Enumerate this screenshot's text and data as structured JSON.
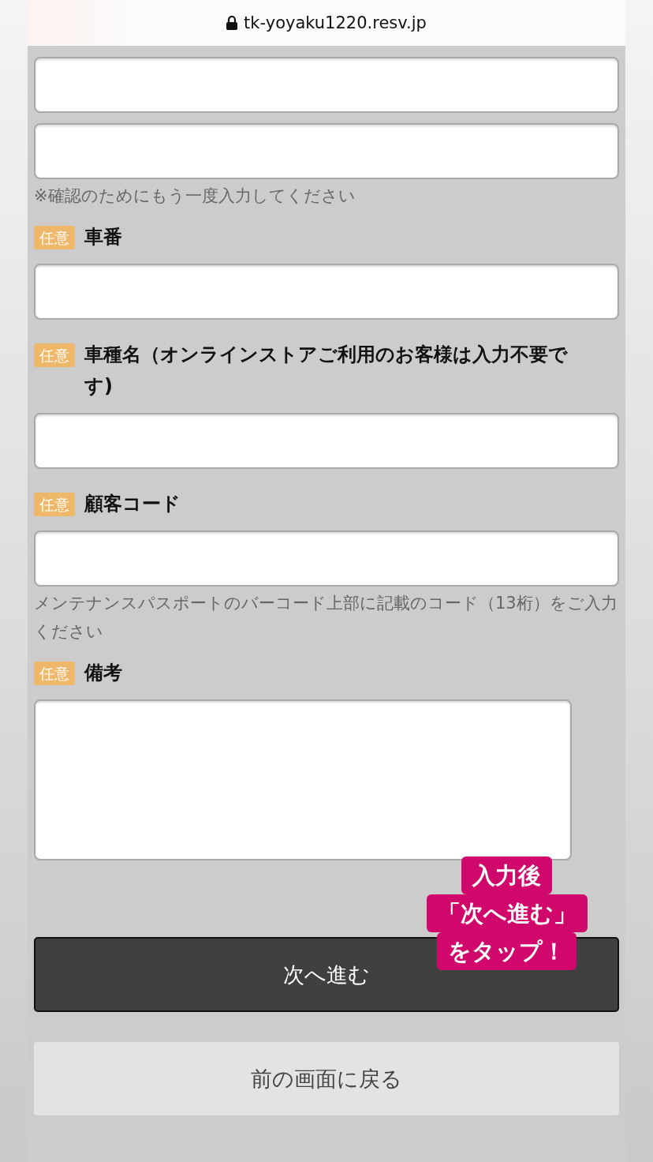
{
  "url_bar": {
    "url": "tk-yoyaku1220.resv.jp"
  },
  "form": [
    {
      "kind": "input"
    },
    {
      "kind": "input",
      "note": "※確認のためにもう一度入力してください"
    },
    {
      "kind": "input",
      "tag": "任意",
      "label": "車番"
    },
    {
      "kind": "input",
      "tag": "任意",
      "label": "車種名（オンラインストアご利用のお客様は入力不要です)"
    },
    {
      "kind": "input",
      "tag": "任意",
      "label": "顧客コード",
      "note": "メンテナンスパスポートのバーコード上部に記載のコード（13桁）をご入力ください"
    },
    {
      "kind": "textarea",
      "tag": "任意",
      "label": "備考"
    }
  ],
  "sticker": {
    "lines": [
      "入力後",
      "「次へ進む」",
      "をタップ！"
    ]
  },
  "buttons": [
    {
      "kind": "primary",
      "label": "次へ進む"
    },
    {
      "kind": "secondary",
      "label": "前の画面に戻る"
    }
  ]
}
